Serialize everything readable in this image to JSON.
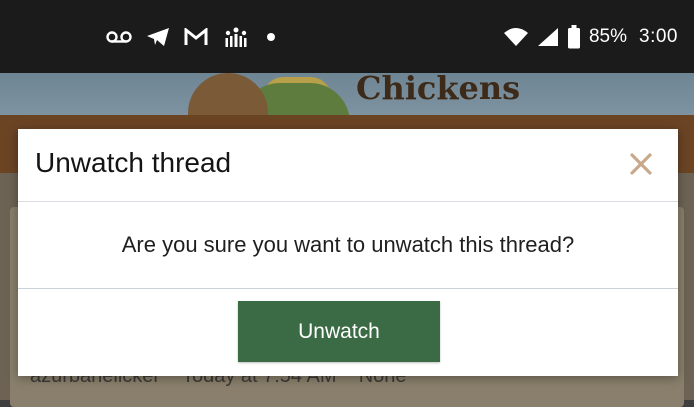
{
  "status_bar": {
    "battery_percent": "85%",
    "time": "3:00",
    "left_icons": [
      "voicemail-icon",
      "telegram-icon",
      "gmail-icon",
      "sun-app-icon",
      "dot-icon"
    ],
    "right_icons": [
      "wifi-icon",
      "cell-signal-icon",
      "battery-icon"
    ]
  },
  "background_site": {
    "logo_text": "Chickens",
    "meta_author": "azurbanelicker",
    "meta_time": "Today at 7:54 AM",
    "meta_tags": "None"
  },
  "modal": {
    "title": "Unwatch thread",
    "message": "Are you sure you want to unwatch this thread?",
    "confirm_label": "Unwatch",
    "close_icon": "close-icon"
  },
  "colors": {
    "button_bg": "#3b6b45",
    "close_icon": "#c9a98c",
    "status_bar_bg": "#1b1b1b"
  }
}
